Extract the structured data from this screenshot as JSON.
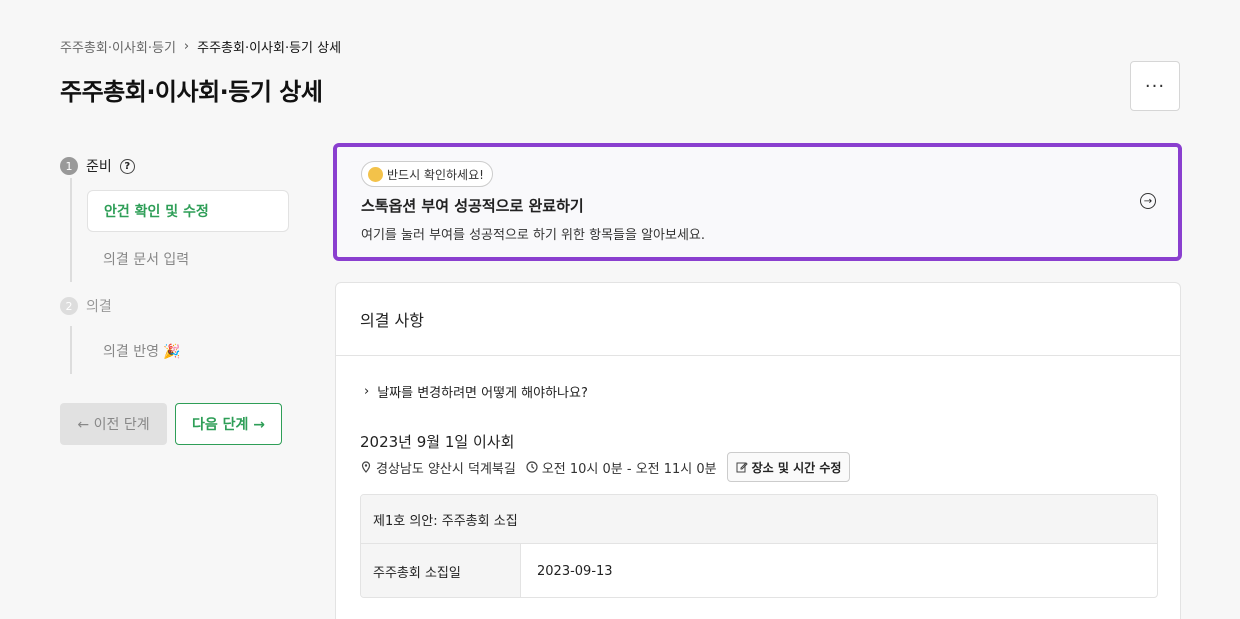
{
  "breadcrumb": {
    "parent": "주주총회·이사회·등기",
    "separator": "›",
    "current": "주주총회·이사회·등기 상세"
  },
  "page_title": "주주총회·이사회·등기 상세",
  "more_button": "···",
  "stepper": {
    "step1": {
      "num": "1",
      "label": "준비",
      "help": "?"
    },
    "step1_items": [
      "안건 확인 및 수정",
      "의결 문서 입력"
    ],
    "step2": {
      "num": "2",
      "label": "의결"
    },
    "step2_items": [
      "의결 반영 🎉"
    ]
  },
  "nav": {
    "prev": "← 이전 단계",
    "next": "다음 단계 →"
  },
  "notice": {
    "badge": "반드시 확인하세요!",
    "title": "스톡옵션 부여 성공적으로 완료하기",
    "desc": "여기를 눌러 부여를 성공적으로 하기 위한 항목들을 알아보세요.",
    "border_color": "#8a3fcf"
  },
  "resolution": {
    "header": "의결 사항",
    "faq": "날짜를 변경하려면 어떻게 해야하나요?",
    "meeting_title": "2023년 9월 1일 이사회",
    "location": "경상남도 양산시 덕계북길",
    "time": "오전 10시 0분 - 오전 11시 0분",
    "edit_button": "장소 및 시간 수정",
    "agenda": {
      "title": "제1호 의안: 주주총회 소집",
      "rows": [
        {
          "label": "주주총회 소집일",
          "value": "2023-09-13"
        }
      ]
    }
  },
  "colors": {
    "accent_green": "#2e9e57",
    "highlight_purple": "#8a3fcf"
  }
}
